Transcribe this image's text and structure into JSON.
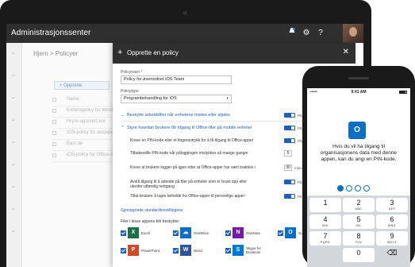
{
  "admin": {
    "title": "Administrasjonssenter",
    "icons": [
      "notification-icon",
      "gear-icon",
      "help-icon"
    ],
    "help_glyph": "?",
    "gear_glyph": "⚙"
  },
  "background": {
    "breadcrumb": "Hjem > Policyer",
    "new_button": "+ Opprette",
    "rows": [
      "Name",
      "Enhetspolicy for Windo",
      "Hryre-agresert ere",
      "IOS-policy for aksjeperio",
      "Bast de",
      "iOS-policy for Office-appe"
    ]
  },
  "panel": {
    "plus": "+",
    "title": "Opprette en policy",
    "close": "✕",
    "name_label": "Policynavn *",
    "name_value": "Policy for øverordnet iOS Team",
    "type_label": "Policytype",
    "type_value": "Programbehandling for iOS",
    "section1": "Beskytte arbeidsfiler når enhetene mistes eller stjeles",
    "section2": "Styre hvordan brukere får tilgang til Office-filer på mobile enheter",
    "toggle_label": "På",
    "settings": [
      {
        "label": "Kreve en PIN-kode eller et fingeravtrykk for å få tilgang til Office-apper",
        "has_toggle": true
      },
      {
        "label": "Tilbakestille PIN-kode når påloggingen mislykkes så mange ganger",
        "value": "5"
      },
      {
        "label": "Kreve at brukere logger på igjen etter at Office-apper har vært inaktive i",
        "value": "30",
        "suffix": "minutter"
      },
      {
        "label": "Avslå tilgang til å arbeide på filer på enheter som er brukt opp eller utenfor utførelig nettgang",
        "has_toggle": true
      },
      {
        "label": "Tillat brukere å lagre beholde fra Office-apper til personlige apper",
        "has_toggle": true
      }
    ],
    "link": "Gjenopprette standardinnstillingene",
    "apps_heading": "Filer i disse appene blir beskyttet:",
    "apps": [
      {
        "name": "Excel",
        "color": "#1e7145",
        "glyph": "X"
      },
      {
        "name": "OneDrive",
        "color": "#0b6fc6",
        "glyph": "☁"
      },
      {
        "name": "OneNote",
        "color": "#7719aa",
        "glyph": "N"
      },
      {
        "name": "Outlook",
        "color": "#0b6fc6",
        "glyph": "O"
      },
      {
        "name": "PowerPoint",
        "color": "#d24726",
        "glyph": "P"
      },
      {
        "name": "Word",
        "color": "#2b579a",
        "glyph": "W"
      },
      {
        "name": "Skype for Business",
        "color": "#0078d7",
        "glyph": "S"
      }
    ]
  },
  "phone": {
    "carrier": "•••••",
    "time": "9:41 AM",
    "app_glyph": "O",
    "prompt": "Hvis du vil ha tilgang til organisasjonens data med denne appen, kan du angi en PIN-kode.",
    "pin_filled": 1,
    "pin_total": 4,
    "keys": [
      {
        "num": "1",
        "sub": ""
      },
      {
        "num": "2",
        "sub": "ABC"
      },
      {
        "num": "3",
        "sub": "DEF"
      },
      {
        "num": "4",
        "sub": "GHI"
      },
      {
        "num": "5",
        "sub": "JKL"
      },
      {
        "num": "6",
        "sub": "MNO"
      },
      {
        "num": "7",
        "sub": "PQRS"
      },
      {
        "num": "8",
        "sub": "TUV"
      },
      {
        "num": "9",
        "sub": "WXYZ"
      },
      {
        "num": "",
        "sub": ""
      },
      {
        "num": "0",
        "sub": ""
      },
      {
        "num": "⌫",
        "sub": ""
      }
    ]
  }
}
